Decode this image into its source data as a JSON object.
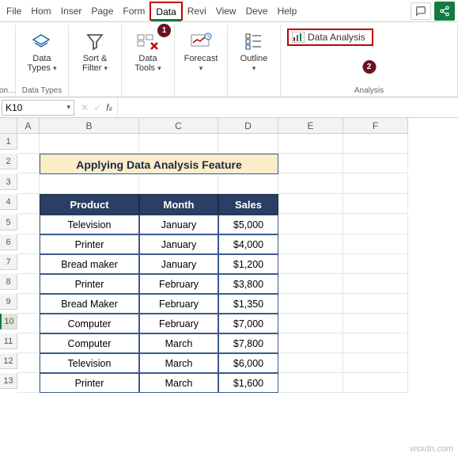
{
  "menu": {
    "items": [
      "File",
      "Hom",
      "Inser",
      "Page",
      "Form",
      "Data",
      "Revi",
      "View",
      "Deve",
      "Help"
    ],
    "active": "Data",
    "comment_icon": "comment-icon",
    "share_icon": "share-icon"
  },
  "ribbon": {
    "stub_label": "on…",
    "data_types": {
      "label": "Data\nTypes",
      "group": "Data Types"
    },
    "sort_filter": {
      "label": "Sort &\nFilter"
    },
    "data_tools": {
      "label": "Data\nTools",
      "callout": "1"
    },
    "forecast": {
      "label": "Forecast"
    },
    "outline": {
      "label": "Outline"
    },
    "analysis": {
      "button": "Data Analysis",
      "group": "Analysis",
      "callout": "2"
    }
  },
  "namebox": {
    "value": "K10"
  },
  "columns": [
    "A",
    "B",
    "C",
    "D",
    "E",
    "F"
  ],
  "rows": [
    "1",
    "2",
    "3",
    "4",
    "5",
    "6",
    "7",
    "8",
    "9",
    "10",
    "11",
    "12",
    "13"
  ],
  "title": "Applying Data Analysis Feature",
  "table": {
    "headers": [
      "Product",
      "Month",
      "Sales"
    ],
    "rows": [
      [
        "Television",
        "January",
        "$5,000"
      ],
      [
        "Printer",
        "January",
        "$4,000"
      ],
      [
        "Bread maker",
        "January",
        "$1,200"
      ],
      [
        "Printer",
        "February",
        "$3,800"
      ],
      [
        "Bread Maker",
        "February",
        "$1,350"
      ],
      [
        "Computer",
        "February",
        "$7,000"
      ],
      [
        "Computer",
        "March",
        "$7,800"
      ],
      [
        "Television",
        "March",
        "$6,000"
      ],
      [
        "Printer",
        "March",
        "$1,600"
      ]
    ]
  },
  "watermark": "wsxdn.com",
  "chart_data": {
    "type": "table",
    "title": "Applying Data Analysis Feature",
    "headers": [
      "Product",
      "Month",
      "Sales"
    ],
    "rows": [
      {
        "Product": "Television",
        "Month": "January",
        "Sales": 5000
      },
      {
        "Product": "Printer",
        "Month": "January",
        "Sales": 4000
      },
      {
        "Product": "Bread maker",
        "Month": "January",
        "Sales": 1200
      },
      {
        "Product": "Printer",
        "Month": "February",
        "Sales": 3800
      },
      {
        "Product": "Bread Maker",
        "Month": "February",
        "Sales": 1350
      },
      {
        "Product": "Computer",
        "Month": "February",
        "Sales": 7000
      },
      {
        "Product": "Computer",
        "Month": "March",
        "Sales": 7800
      },
      {
        "Product": "Television",
        "Month": "March",
        "Sales": 6000
      },
      {
        "Product": "Printer",
        "Month": "March",
        "Sales": 1600
      }
    ]
  }
}
